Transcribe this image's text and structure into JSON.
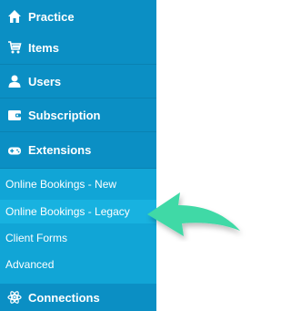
{
  "nav": {
    "practice": "Practice",
    "items": "Items",
    "users": "Users",
    "subscription": "Subscription",
    "extensions": "Extensions",
    "connections": "Connections"
  },
  "submenu": {
    "items": [
      "Online Bookings - New",
      "Online Bookings - Legacy",
      "Client Forms",
      "Advanced"
    ]
  },
  "colors": {
    "sidebar": "#0b8fc4",
    "submenu": "#11a5d6",
    "arrow": "#3fd9a6"
  },
  "icons": {
    "practice": "home-icon",
    "items": "shopping-cart-icon",
    "users": "user-icon",
    "subscription": "wallet-icon",
    "extensions": "gamepad-icon",
    "connections": "atom-icon"
  }
}
